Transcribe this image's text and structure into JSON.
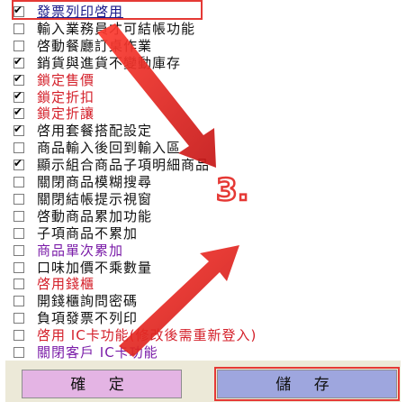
{
  "options": [
    {
      "label": "發票列印啓用",
      "checked": true,
      "color": "#1a1a8a"
    },
    {
      "label": "輸入業務員才可結帳功能",
      "checked": false,
      "color": "#111111"
    },
    {
      "label": "啓動餐廳訂桌作業",
      "checked": false,
      "color": "#111111"
    },
    {
      "label": "銷貨與進貨不變動庫存",
      "checked": true,
      "color": "#111111"
    },
    {
      "label": "鎖定售價",
      "checked": true,
      "color": "#d4202a"
    },
    {
      "label": "鎖定折扣",
      "checked": true,
      "color": "#d4202a"
    },
    {
      "label": "鎖定折讓",
      "checked": true,
      "color": "#d4202a"
    },
    {
      "label": "啓用套餐搭配設定",
      "checked": true,
      "color": "#111111"
    },
    {
      "label": "商品輸入後回到輸入區",
      "checked": false,
      "color": "#111111"
    },
    {
      "label": "顯示組合商品子項明細商品",
      "checked": true,
      "color": "#111111"
    },
    {
      "label": "關閉商品模糊搜尋",
      "checked": false,
      "color": "#111111"
    },
    {
      "label": "關閉結帳提示視窗",
      "checked": false,
      "color": "#111111"
    },
    {
      "label": "啓動商品累加功能",
      "checked": false,
      "color": "#111111"
    },
    {
      "label": "子項商品不累加",
      "checked": false,
      "color": "#111111"
    },
    {
      "label": "商品單次累加",
      "checked": false,
      "color": "#7a1ca8"
    },
    {
      "label": "口味加價不乘數量",
      "checked": false,
      "color": "#111111"
    },
    {
      "label": "啓用錢櫃",
      "checked": false,
      "color": "#d4202a"
    },
    {
      "label": "開錢櫃詢問密碼",
      "checked": false,
      "color": "#111111"
    },
    {
      "label": "負項發票不列印",
      "checked": false,
      "color": "#111111"
    },
    {
      "label": "啓用 IC卡功能(修改後需重新登入)",
      "checked": false,
      "color": "#d4202a"
    },
    {
      "label": "關閉客戶 IC卡功能",
      "checked": false,
      "color": "#7a1ca8"
    }
  ],
  "buttons": {
    "confirm": "確 定",
    "save": "儲 存"
  },
  "annotation": {
    "step_label": "3."
  },
  "colors": {
    "annotation_red": "#e53935",
    "confirm_bg": "#e4b4e4",
    "save_bg": "#9ea6de"
  }
}
